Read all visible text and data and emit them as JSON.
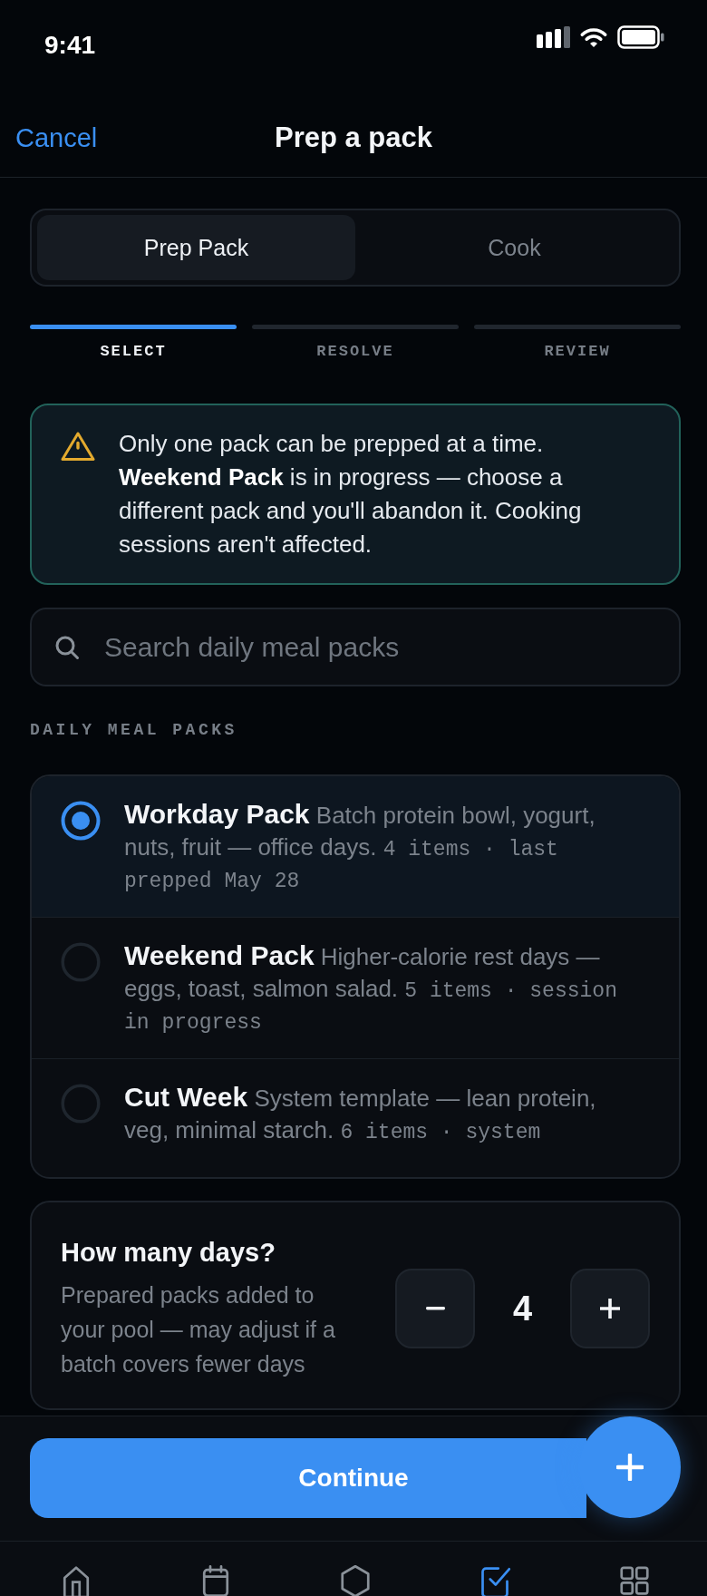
{
  "status_bar": {
    "time": "9:41"
  },
  "nav": {
    "cancel": "Cancel",
    "title": "Prep a pack"
  },
  "mode_tabs": [
    {
      "label": "Prep Pack",
      "selected": true
    },
    {
      "label": "Cook",
      "selected": false
    }
  ],
  "steps": [
    {
      "label": "SELECT",
      "current": true
    },
    {
      "label": "RESOLVE",
      "current": false
    },
    {
      "label": "REVIEW",
      "current": false
    }
  ],
  "alert": {
    "text": "Only one pack can be prepped at a time. **Weekend Pack** is in progress — choose a different pack and you'll abandon it. Cooking sessions aren't affected."
  },
  "search": {
    "placeholder": "Search daily meal packs"
  },
  "section_label": "DAILY MEAL PACKS",
  "packs": [
    {
      "name": "Workday Pack",
      "description": "Batch protein bowl, yogurt, nuts, fruit — office days.",
      "meta": "4 items · last prepped May 28",
      "selected": true
    },
    {
      "name": "Weekend Pack",
      "description": "Higher-calorie rest days — eggs, toast, salmon salad.",
      "meta": "5 items · session in progress",
      "selected": false
    },
    {
      "name": "Cut Week",
      "description": "System template — lean protein, veg, minimal starch.",
      "meta": "6 items · system",
      "selected": false
    }
  ],
  "days": {
    "title": "How many days?",
    "hint": "Prepared packs added to your pool — may adjust if a batch covers fewer days",
    "value": "4"
  },
  "continue_button": "Continue",
  "tab_bar": [
    {
      "selected": false
    },
    {
      "selected": false
    },
    {
      "selected": false
    },
    {
      "selected": true
    },
    {
      "selected": false
    }
  ]
}
